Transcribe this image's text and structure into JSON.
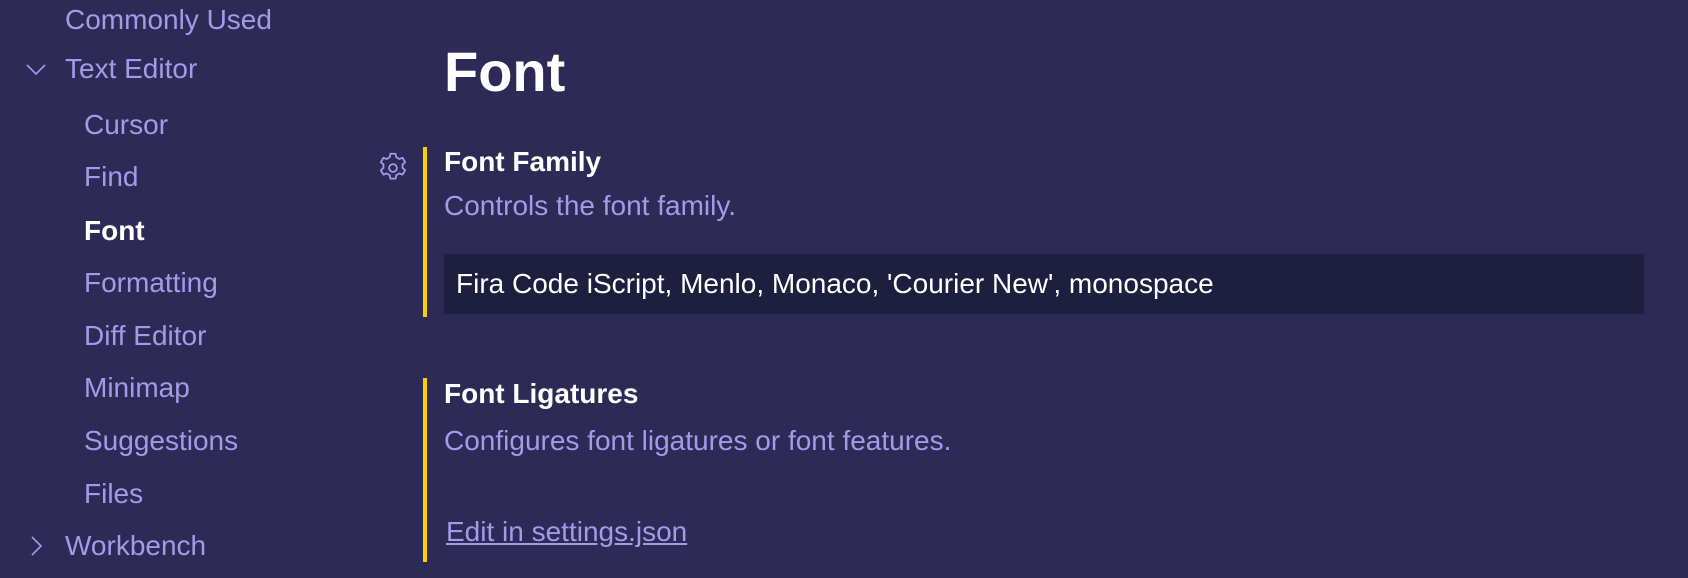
{
  "sidebar": {
    "items": [
      {
        "label": "Commonly Used",
        "level": 0,
        "active": false
      },
      {
        "label": "Text Editor",
        "level": 0,
        "expanded": true
      },
      {
        "label": "Cursor",
        "level": 1
      },
      {
        "label": "Find",
        "level": 1
      },
      {
        "label": "Font",
        "level": 1,
        "active": true
      },
      {
        "label": "Formatting",
        "level": 1
      },
      {
        "label": "Diff Editor",
        "level": 1
      },
      {
        "label": "Minimap",
        "level": 1
      },
      {
        "label": "Suggestions",
        "level": 1
      },
      {
        "label": "Files",
        "level": 1
      },
      {
        "label": "Workbench",
        "level": 0,
        "expanded": false
      }
    ]
  },
  "main": {
    "title": "Font",
    "settings": [
      {
        "title": "Font Family",
        "description": "Controls the font family.",
        "value": "Fira Code iScript, Menlo, Monaco, 'Courier New', monospace"
      },
      {
        "title": "Font Ligatures",
        "description": "Configures font ligatures or font features.",
        "link": "Edit in settings.json"
      }
    ]
  },
  "colors": {
    "background": "#2d2b55",
    "accent": "#fad000",
    "text_muted": "#a599e9",
    "input_bg": "#1e1e3f"
  }
}
